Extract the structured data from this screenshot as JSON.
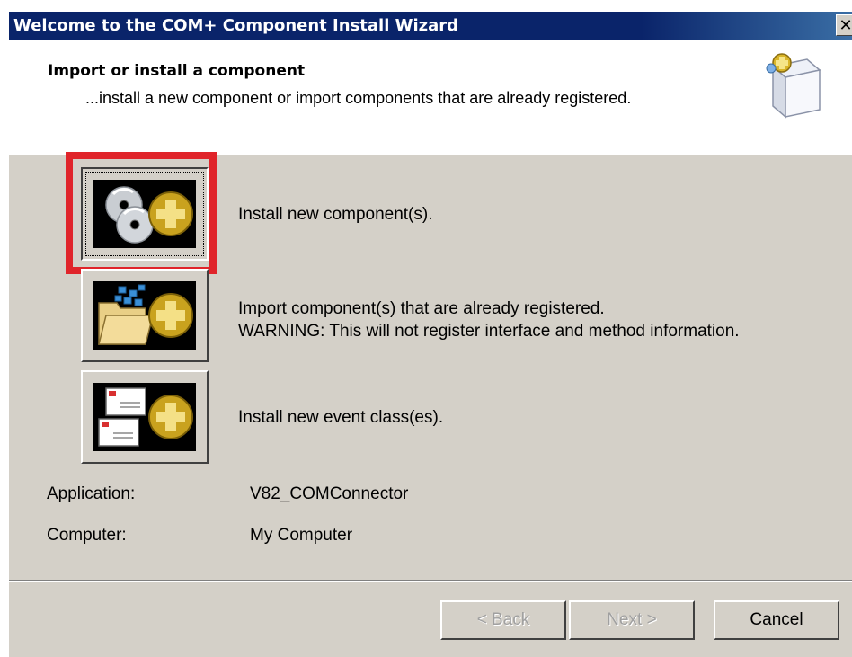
{
  "window": {
    "title": "Welcome to the COM+ Component Install Wizard",
    "close_label": "✕"
  },
  "header": {
    "title": "Import or install a component",
    "subtitle": "...install a new component or import components that are already registered.",
    "icon": "wizard-box-icon"
  },
  "options": [
    {
      "icon": "cd-disks-plus-icon",
      "line1": "Install new component(s).",
      "line2": "",
      "selected": true
    },
    {
      "icon": "folder-plus-icon",
      "line1": "Import component(s) that are already registered.",
      "line2": "WARNING: This will not register interface and method information.",
      "selected": false
    },
    {
      "icon": "envelopes-plus-icon",
      "line1": "Install new event class(es).",
      "line2": "",
      "selected": false
    }
  ],
  "info": {
    "application_label": "Application:",
    "application_value": "V82_COMConnector",
    "computer_label": "Computer:",
    "computer_value": "My Computer"
  },
  "buttons": {
    "back": "< Back",
    "next": "Next >",
    "cancel": "Cancel",
    "back_enabled": false,
    "next_enabled": false
  },
  "colors": {
    "titlebar": "#0a246a",
    "highlight": "#e0242a",
    "dialog_bg": "#d4d0c8"
  }
}
